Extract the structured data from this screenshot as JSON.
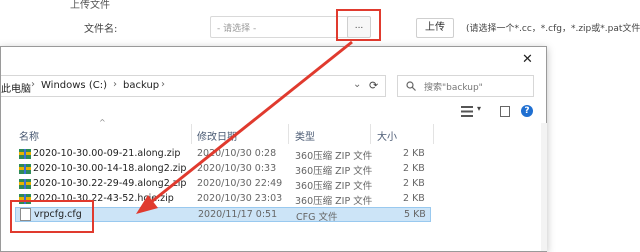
{
  "web": {
    "section_title": "上传文件",
    "field_label": "文件名:",
    "file_placeholder": "- 请选择 -",
    "browse_label": "...",
    "upload_label": "上传",
    "hint": "(请选择一个*.cc，*.cfg，*.zip或*.pat文件)"
  },
  "dialog": {
    "breadcrumb": [
      "此电脑",
      "Windows (C:)",
      "backup"
    ],
    "search_placeholder": "搜索\"backup\"",
    "columns": [
      "名称",
      "修改日期",
      "类型",
      "大小"
    ],
    "files": [
      {
        "name": "2020-10-30.00-09-21.along.zip",
        "date": "2020/10/30 0:28",
        "type": "360压缩 ZIP 文件",
        "size": "2 KB",
        "icon": "zip-icon",
        "selected": false
      },
      {
        "name": "2020-10-30.00-14-18.along2.zip",
        "date": "2020/10/30 0:33",
        "type": "360压缩 ZIP 文件",
        "size": "2 KB",
        "icon": "zip-icon",
        "selected": false
      },
      {
        "name": "2020-10-30.22-29-49.along2.zip",
        "date": "2020/10/30 22:49",
        "type": "360压缩 ZIP 文件",
        "size": "2 KB",
        "icon": "zip-icon",
        "selected": false
      },
      {
        "name": "2020-10-30.22-43-52.hcie.zip",
        "date": "2020/10/30 23:03",
        "type": "360压缩 ZIP 文件",
        "size": "2 KB",
        "icon": "zip-icon",
        "selected": false
      },
      {
        "name": "vrpcfg.cfg",
        "date": "2020/11/17 0:51",
        "type": "CFG 文件",
        "size": "5 KB",
        "icon": "cfg-file-icon",
        "selected": true
      }
    ]
  },
  "colors": {
    "annotation_red": "#e03a2e",
    "selection_bg": "#cce4f7",
    "help_blue": "#1f6fd1"
  }
}
